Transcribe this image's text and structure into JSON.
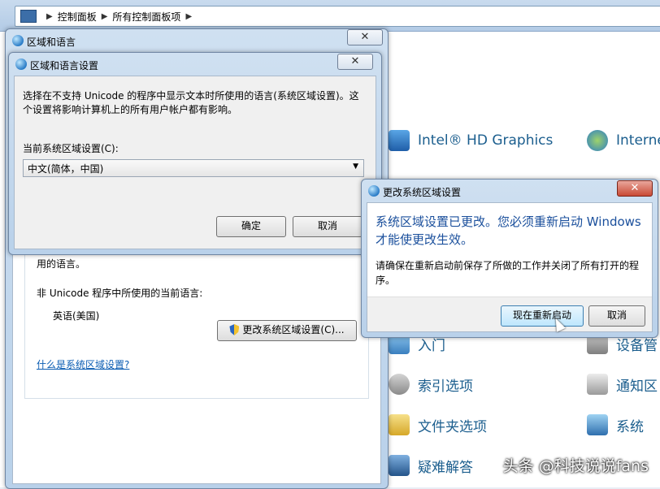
{
  "control_panel": {
    "breadcrumb": [
      "控制面板",
      "所有控制面板项"
    ],
    "items": [
      {
        "label": "Intel® HD Graphics",
        "icon": "intel-graphics-icon"
      },
      {
        "label": "Interne",
        "icon": "internet-options-icon"
      },
      {
        "label": "入门",
        "icon": "getting-started-icon"
      },
      {
        "label": "设备管",
        "icon": "device-manager-icon"
      },
      {
        "label": "索引选项",
        "icon": "indexing-options-icon"
      },
      {
        "label": "通知区",
        "icon": "notification-area-icon"
      },
      {
        "label": "文件夹选项",
        "icon": "folder-options-icon"
      },
      {
        "label": "系统",
        "icon": "system-icon"
      },
      {
        "label": "疑难解答",
        "icon": "troubleshooting-icon"
      }
    ]
  },
  "region_window": {
    "title": "区域和语言",
    "behind_text": "用的语言。",
    "non_unicode_label": "非 Unicode 程序中所使用的当前语言:",
    "current_language": "英语(美国)",
    "change_locale_button": "更改系统区域设置(C)...",
    "what_is_link": "什么是系统区域设置?"
  },
  "locale_dialog": {
    "title": "区域和语言设置",
    "description": "选择在不支持 Unicode 的程序中显示文本时所使用的语言(系统区域设置)。这个设置将影响计算机上的所有用户帐户都有影响。",
    "current_label": "当前系统区域设置(C):",
    "selected_value": "中文(简体，中国)",
    "ok_button": "确定",
    "cancel_button": "取消"
  },
  "restart_dialog": {
    "title": "更改系统区域设置",
    "headline": "系统区域设置已更改。您必须重新启动 Windows 才能使更改生效。",
    "body": "请确保在重新启动前保存了所做的工作并关闭了所有打开的程序。",
    "restart_button": "现在重新启动",
    "cancel_button": "取消"
  },
  "watermark": "头条 @科技说说fans"
}
